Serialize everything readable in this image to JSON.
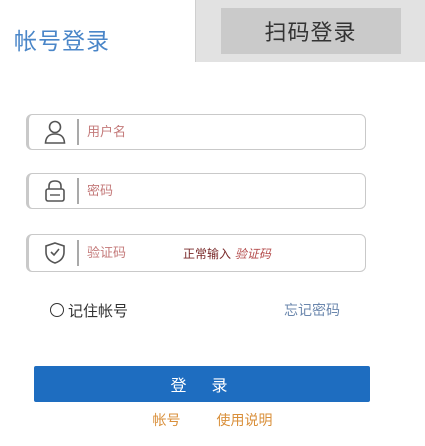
{
  "tabs": {
    "account_login": "帐号登录",
    "qr_login": "扫码登录"
  },
  "form": {
    "username_placeholder": "用户名",
    "password_placeholder": "密码",
    "captcha_placeholder": "验证码",
    "captcha_text": "正常输入 ",
    "captcha_highlight": "验证码",
    "captcha_hint_prefix": "正常输入"
  },
  "options": {
    "remember_label": "记住帐号",
    "forgot_label": "忘记密码"
  },
  "login_button": "登 录",
  "links": {
    "register": "帐号",
    "help": "使用说明"
  },
  "colors": {
    "accent": "#1e6dc0",
    "tab_text": "#4a86c8",
    "link": "#d98f3a"
  }
}
